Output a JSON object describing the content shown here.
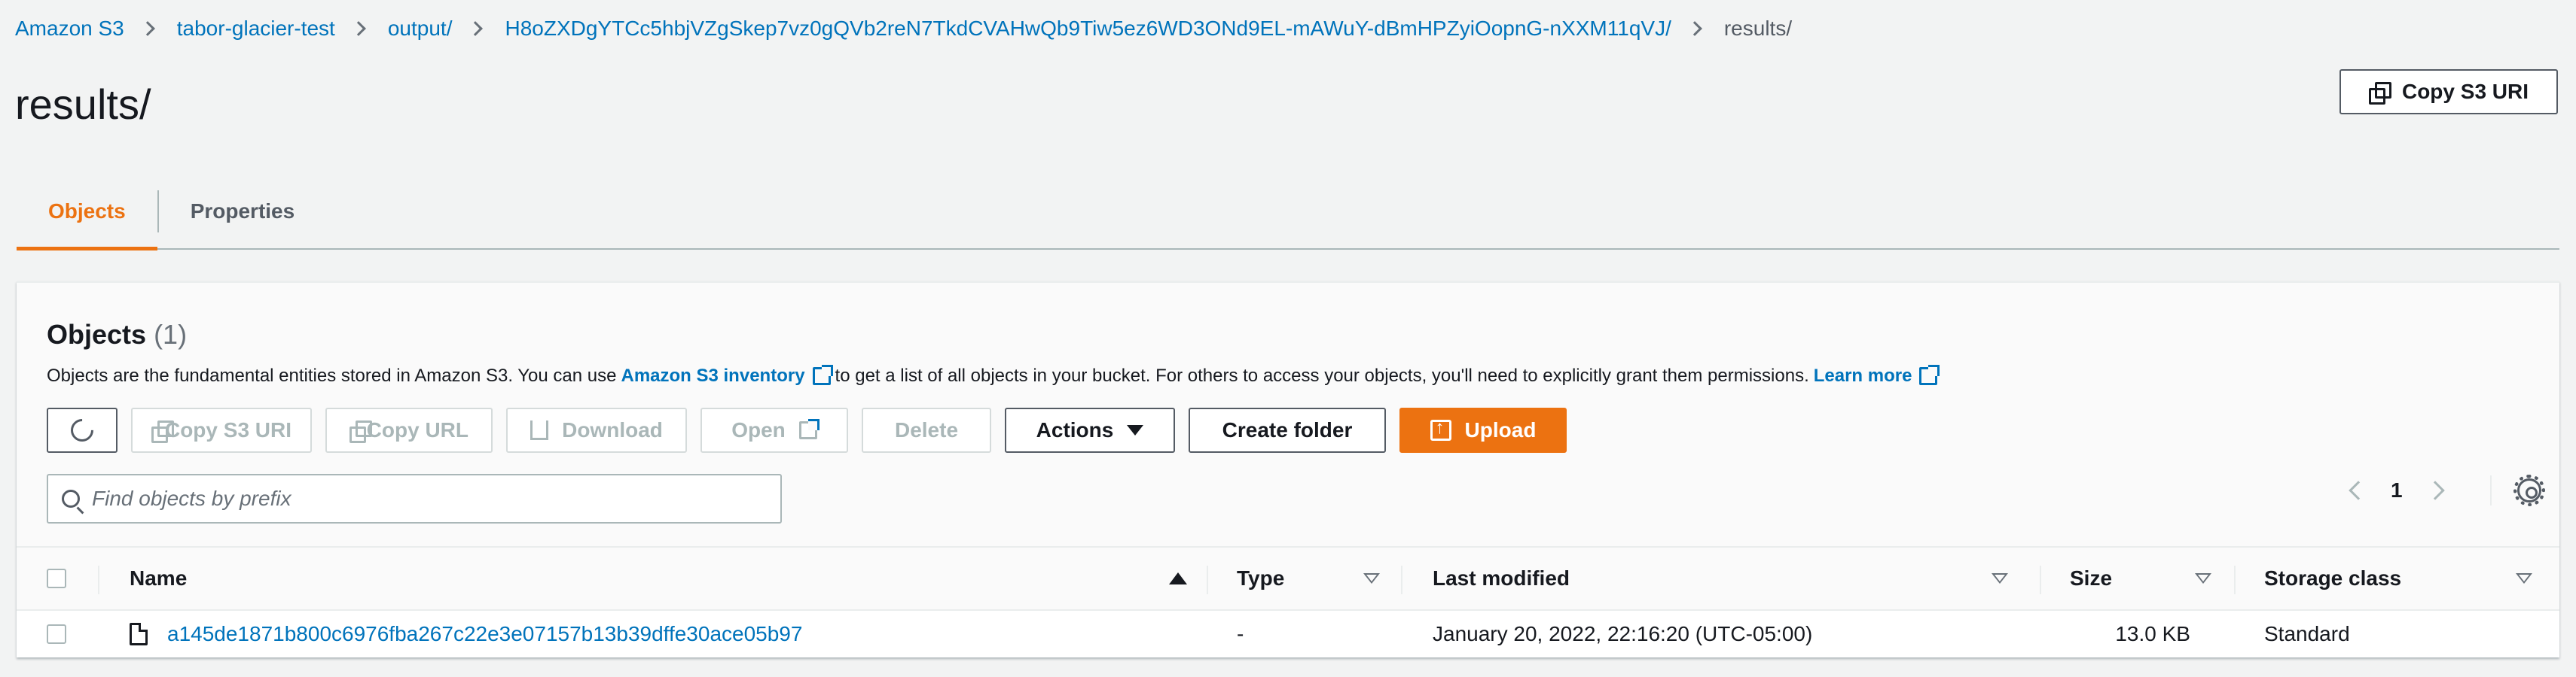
{
  "breadcrumb": {
    "items": [
      "Amazon S3",
      "tabor-glacier-test",
      "output/",
      "H8oZXDgYTCc5hbjVZgSkep7vz0gQVb2reN7TkdCVAHwQb9Tiw5ez6WD3ONd9EL-mAWuY-dBmHPZyiOopnG-nXXM11qVJ/"
    ],
    "current": "results/"
  },
  "page": {
    "title": "results/",
    "copy_uri_label": "Copy S3 URI"
  },
  "tabs": [
    {
      "label": "Objects",
      "active": true
    },
    {
      "label": "Properties",
      "active": false
    }
  ],
  "objects": {
    "heading": "Objects",
    "count": "(1)",
    "desc_before": "Objects are the fundamental entities stored in Amazon S3. You can use",
    "inventory_link": "Amazon S3 inventory",
    "desc_middle": "to get a list of all objects in your bucket. For others to access your objects, you'll need to explicitly grant them permissions.",
    "learn_more": "Learn more"
  },
  "toolbar": {
    "copy_s3_uri": "Copy S3 URI",
    "copy_url": "Copy URL",
    "download": "Download",
    "open": "Open",
    "delete": "Delete",
    "actions": "Actions",
    "create_folder": "Create folder",
    "upload": "Upload"
  },
  "search": {
    "placeholder": "Find objects by prefix"
  },
  "pagination": {
    "page": "1"
  },
  "table": {
    "columns": {
      "name": "Name",
      "type": "Type",
      "last_modified": "Last modified",
      "size": "Size",
      "storage_class": "Storage class"
    },
    "rows": [
      {
        "name": "a145de1871b800c6976fba267c22e3e07157b13b39dffe30ace05b97",
        "type": "-",
        "last_modified": "January 20, 2022, 22:16:20 (UTC-05:00)",
        "size": "13.0 KB",
        "storage_class": "Standard"
      }
    ]
  },
  "colors": {
    "accent": "#ec7211",
    "link": "#0073bb",
    "text": "#16191f",
    "background": "#f2f3f3"
  }
}
